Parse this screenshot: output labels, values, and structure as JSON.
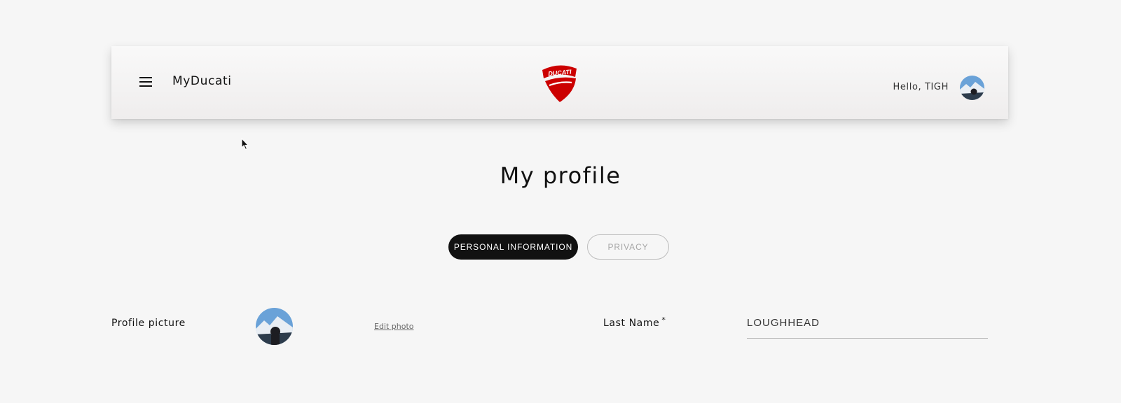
{
  "header": {
    "app_title": "MyDucati",
    "logo_text": "DUCATI",
    "greeting": "Hello, TIGH",
    "menu_icon": "hamburger-menu-icon"
  },
  "page": {
    "title": "My profile"
  },
  "tabs": [
    {
      "label": "PERSONAL INFORMATION",
      "active": true
    },
    {
      "label": "PRIVACY",
      "active": false
    }
  ],
  "form": {
    "profile_picture_label": "Profile picture",
    "edit_photo_label": "Edit photo",
    "last_name_label": "Last Name",
    "last_name_required_marker": "*",
    "last_name_value": "LOUGHHEAD"
  },
  "colors": {
    "brand_red": "#cc0000",
    "active_tab_bg": "#111111",
    "background": "#f6f6f6"
  }
}
